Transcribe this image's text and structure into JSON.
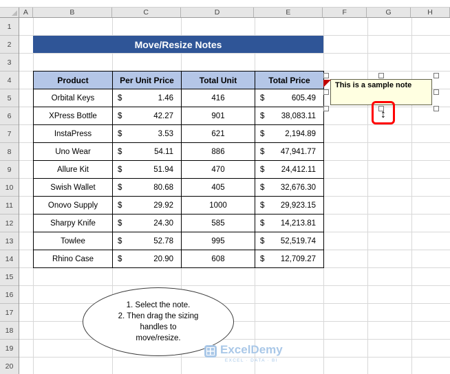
{
  "sheet": {
    "column_letters": [
      "A",
      "B",
      "C",
      "D",
      "E",
      "F",
      "G",
      "H"
    ],
    "row_numbers": [
      "1",
      "2",
      "3",
      "4",
      "5",
      "6",
      "7",
      "8",
      "9",
      "10",
      "11",
      "12",
      "13",
      "14",
      "15",
      "16",
      "17",
      "18",
      "19",
      "20"
    ]
  },
  "banner": {
    "title": "Move/Resize Notes",
    "bg_color": "#2F5597",
    "text_color": "#FFFFFF"
  },
  "table": {
    "currency_symbol": "$",
    "header_bg_color": "#B4C6E7",
    "headers": [
      "Product",
      "Per Unit Price",
      "Total Unit",
      "Total Price"
    ],
    "rows": [
      {
        "product": "Orbital Keys",
        "per_unit_price": "1.46",
        "total_unit": "416",
        "total_price": "605.49"
      },
      {
        "product": "XPress Bottle",
        "per_unit_price": "42.27",
        "total_unit": "901",
        "total_price": "38,083.11"
      },
      {
        "product": "InstaPress",
        "per_unit_price": "3.53",
        "total_unit": "621",
        "total_price": "2,194.89"
      },
      {
        "product": "Uno Wear",
        "per_unit_price": "54.11",
        "total_unit": "886",
        "total_price": "47,941.77"
      },
      {
        "product": "Allure Kit",
        "per_unit_price": "51.94",
        "total_unit": "470",
        "total_price": "24,412.11"
      },
      {
        "product": "Swish Wallet",
        "per_unit_price": "80.68",
        "total_unit": "405",
        "total_price": "32,676.30"
      },
      {
        "product": "Onovo Supply",
        "per_unit_price": "29.92",
        "total_unit": "1000",
        "total_price": "29,923.15"
      },
      {
        "product": "Sharpy Knife",
        "per_unit_price": "24.30",
        "total_unit": "585",
        "total_price": "14,213.81"
      },
      {
        "product": "Towlee",
        "per_unit_price": "52.78",
        "total_unit": "995",
        "total_price": "52,519.74"
      },
      {
        "product": "Rhino Case",
        "per_unit_price": "20.90",
        "total_unit": "608",
        "total_price": "12,709.27"
      }
    ]
  },
  "note": {
    "text": "This is a sample note",
    "bg_color": "#FFFFE1"
  },
  "resize_annotation": {
    "cursor_glyph": "↕",
    "highlight_color": "#FF0000"
  },
  "instruction_oval": {
    "lines": [
      "1. Select the  note.",
      "2. Then drag the sizing",
      "handles to",
      "move/resize."
    ]
  },
  "watermark": {
    "name": "ExcelDemy",
    "tagline": "EXCEL · DATA · BI",
    "color": "#A6C6E7"
  }
}
